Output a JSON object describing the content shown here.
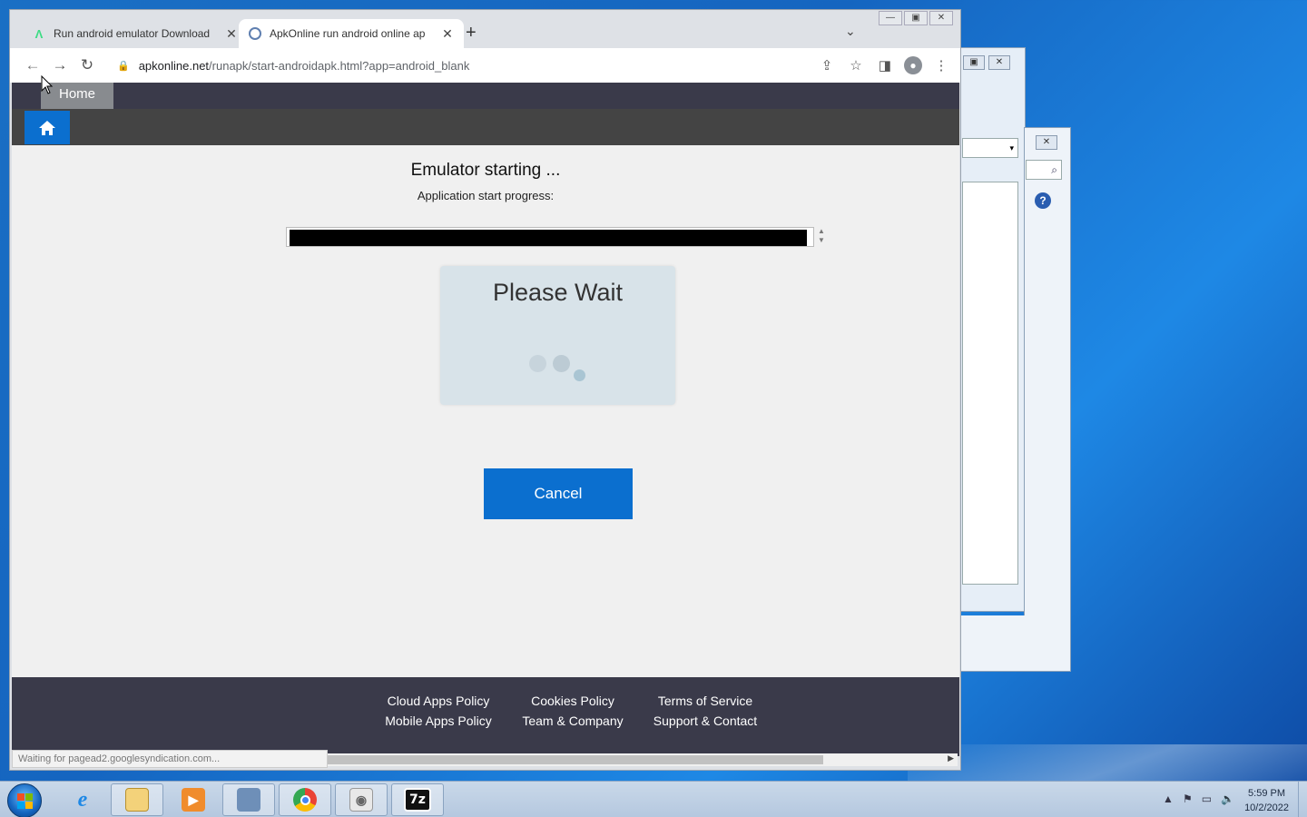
{
  "browser": {
    "tabs": [
      {
        "label": "Run android emulator Download",
        "active": false,
        "icon": "android-icon"
      },
      {
        "label": "ApkOnline run android online ap",
        "active": true,
        "icon": "globe-icon"
      }
    ],
    "new_tab_symbol": "+",
    "url": {
      "domain": "apkonline.net",
      "path": "/runapk/start-androidapk.html?app=android_blank"
    },
    "status_text": "Waiting for pagead2.googlesyndication.com..."
  },
  "page": {
    "nav": {
      "home_label": "Home"
    },
    "title": "Emulator starting ...",
    "subtitle": "Application start progress:",
    "progress": 0.99,
    "wait_title": "Please Wait",
    "cancel_label": "Cancel",
    "footer": {
      "col1": [
        "Cloud Apps Policy",
        "Mobile Apps Policy"
      ],
      "col2": [
        "Cookies Policy",
        "Team & Company"
      ],
      "col3": [
        "Terms of Service",
        "Support & Contact"
      ]
    },
    "colors": {
      "accent": "#0b6fcf",
      "nav_bg": "#3a3a4a",
      "progress_fill": "#000000"
    }
  },
  "taskbar": {
    "apps": [
      "internet-explorer-icon",
      "file-explorer-icon",
      "media-player-icon",
      "network-app-icon",
      "chrome-icon",
      "disk-utility-icon",
      "7zip-icon"
    ],
    "sevenzip_label": "7z",
    "clock_time": "5:59 PM",
    "clock_date": "10/2/2022"
  }
}
